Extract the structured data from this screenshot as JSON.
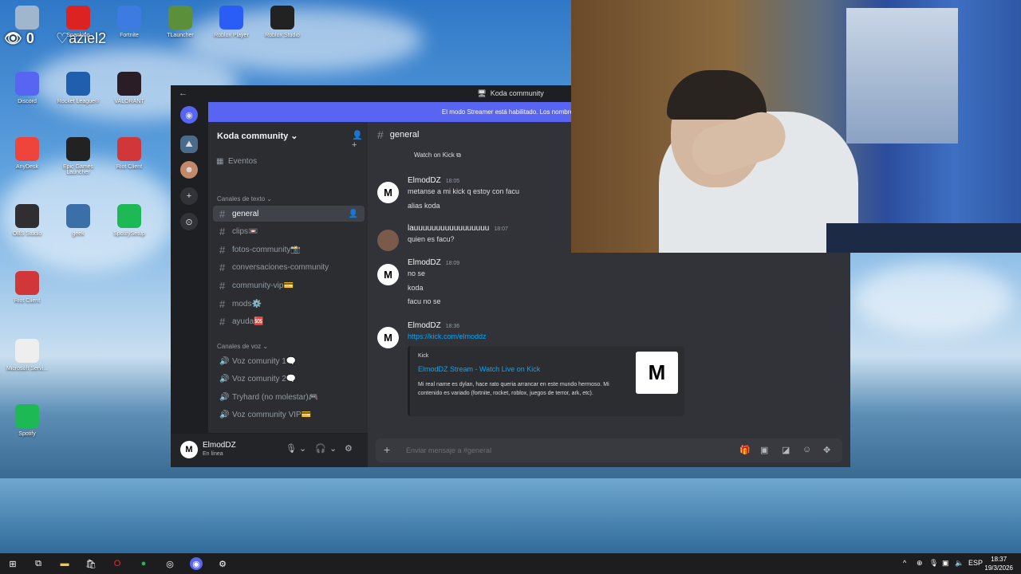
{
  "desktop": {
    "overlay": {
      "count": "0",
      "name": "aziel2"
    },
    "icons": [
      {
        "label": "",
        "icon": "recycle-bin-icon",
        "color": "#9fb6cc"
      },
      {
        "label": "Spanking",
        "icon": "app-icon",
        "color": "#d22"
      },
      {
        "label": "Fortnite",
        "icon": "fortnite-icon",
        "color": "#3d7be0"
      },
      {
        "label": "TLauncher",
        "icon": "minecraft-icon",
        "color": "#5b8f3a"
      },
      {
        "label": "Roblox Player",
        "icon": "roblox-icon",
        "color": "#2a5df5"
      },
      {
        "label": "Roblox Studio",
        "icon": "roblox-studio-icon",
        "color": "#222"
      },
      {
        "label": "Discord",
        "icon": "discord-icon",
        "color": "#5865f2"
      },
      {
        "label": "Rocket League®",
        "icon": "rocket-league-icon",
        "color": "#1f5fae"
      },
      {
        "label": "VALORANT",
        "icon": "valorant-icon",
        "color": "#2a1d25"
      },
      {
        "label": "AnyDesk",
        "icon": "anydesk-icon",
        "color": "#ef443b"
      },
      {
        "label": "Epic Games Launcher",
        "icon": "epic-games-icon",
        "color": "#222"
      },
      {
        "label": "Riot Client",
        "icon": "riot-client-icon",
        "color": "#d13639"
      },
      {
        "label": "OBS Studio",
        "icon": "obs-icon",
        "color": "#302e31"
      },
      {
        "label": "geek",
        "icon": "geek-icon",
        "color": "#3a6fa8"
      },
      {
        "label": "SpotifySetup",
        "icon": "spotify-setup-icon",
        "color": "#1db954"
      },
      {
        "label": "Riot Client",
        "icon": "riot-client-icon",
        "color": "#d13639"
      },
      {
        "label": "Microsoft Servi...",
        "icon": "file-icon",
        "color": "#eeeeee"
      },
      {
        "label": "Spotify",
        "icon": "spotify-icon",
        "color": "#1db954"
      }
    ]
  },
  "discord": {
    "window_title": "Koda community",
    "streamer_banner": "El modo Streamer está habilitado. Los nombres de usuario se",
    "server_name": "Koda community",
    "events_label": "Eventos",
    "text_category": "Canales de texto",
    "text_channels": [
      {
        "name": "general",
        "active": true
      },
      {
        "name": "clips📼",
        "active": false
      },
      {
        "name": "fotos-community📸",
        "active": false
      },
      {
        "name": "conversaciones-community",
        "active": false
      },
      {
        "name": "community-vip💳",
        "active": false
      },
      {
        "name": "mods⚙️",
        "active": false
      },
      {
        "name": "ayuda🆘",
        "active": false
      }
    ],
    "voice_category": "Canales de voz",
    "voice_channels": [
      {
        "name": "Voz comunity 1🗨️"
      },
      {
        "name": "Voz comunity 2🗨️"
      },
      {
        "name": "Tryhard (no molestar)🎮"
      },
      {
        "name": "Voz community VIP💳"
      }
    ],
    "user": {
      "name": "ElmodDZ",
      "status": "En línea"
    },
    "chat": {
      "channel": "general",
      "watch_label": "Watch on Kick",
      "messages": [
        {
          "author": "ElmodDZ",
          "time": "18:05",
          "lines": [
            "metanse a mi kick q estoy con facu",
            "alias koda"
          ]
        },
        {
          "author": "lauuuuuuuuuuuuuuuuu",
          "time": "18:07",
          "lines": [
            "quien es facu?"
          ]
        },
        {
          "author": "ElmodDZ",
          "time": "18:09",
          "lines": [
            "no se",
            "koda",
            "facu no se"
          ]
        },
        {
          "author": "ElmodDZ",
          "time": "18:36",
          "lines": [
            "https://kick.com/elmoddz"
          ]
        }
      ],
      "embed": {
        "provider": "Kick",
        "title": "ElmodDZ Stream - Watch Live on Kick",
        "description": "Mi real name es dylan, hace rato queria arrancar en este mundo hermoso. Mi contenido es variado (fortnite, rocket, roblox, juegos de terror, ark, etc)."
      },
      "composer_placeholder": "Enviar mensaje a #general"
    }
  },
  "taskbar": {
    "lang": "ESP",
    "time": "18:37",
    "date": "19/3/2026"
  }
}
